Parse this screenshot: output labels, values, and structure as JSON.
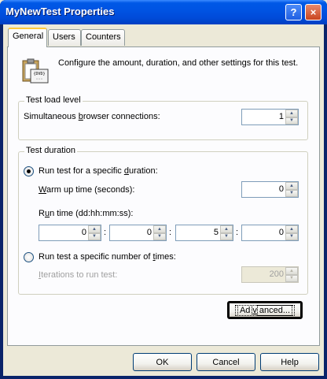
{
  "window": {
    "title": "MyNewTest Properties",
    "help_button": "?",
    "close_button": "×"
  },
  "tabs": [
    "General",
    "Users",
    "Counters"
  ],
  "intro": {
    "icon_caption": "{DVD}",
    "text": "Configure the amount, duration, and other settings for this test."
  },
  "load_level": {
    "title": "Test load level",
    "connections_label_pre": "Simultaneous ",
    "connections_label_key": "b",
    "connections_label_post": "rowser connections:",
    "connections_value": "1"
  },
  "duration": {
    "title": "Test duration",
    "option_specific_duration": {
      "pre": "Run test for a specific ",
      "key": "d",
      "post": "uration:",
      "checked": true
    },
    "warmup_label_pre": "",
    "warmup_label_key": "W",
    "warmup_label_post": "arm up time (seconds):",
    "warmup_value": "0",
    "runtime_label_pre": "R",
    "runtime_label_key": "u",
    "runtime_label_post": "n time (dd:hh:mm:ss):",
    "runtime_values": [
      "0",
      "0",
      "5",
      "0"
    ],
    "separator": ":",
    "option_iterations": {
      "pre": "Run test a specific number of ",
      "key": "t",
      "post": "imes:",
      "checked": false
    },
    "iterations_label_pre": "",
    "iterations_label_key": "I",
    "iterations_label_post": "terations to run test:",
    "iterations_value": "200"
  },
  "advanced_button": {
    "pre": "Ad",
    "key": "v",
    "post": "anced..."
  },
  "footer": {
    "ok": "OK",
    "cancel": "Cancel",
    "help": "Help"
  }
}
